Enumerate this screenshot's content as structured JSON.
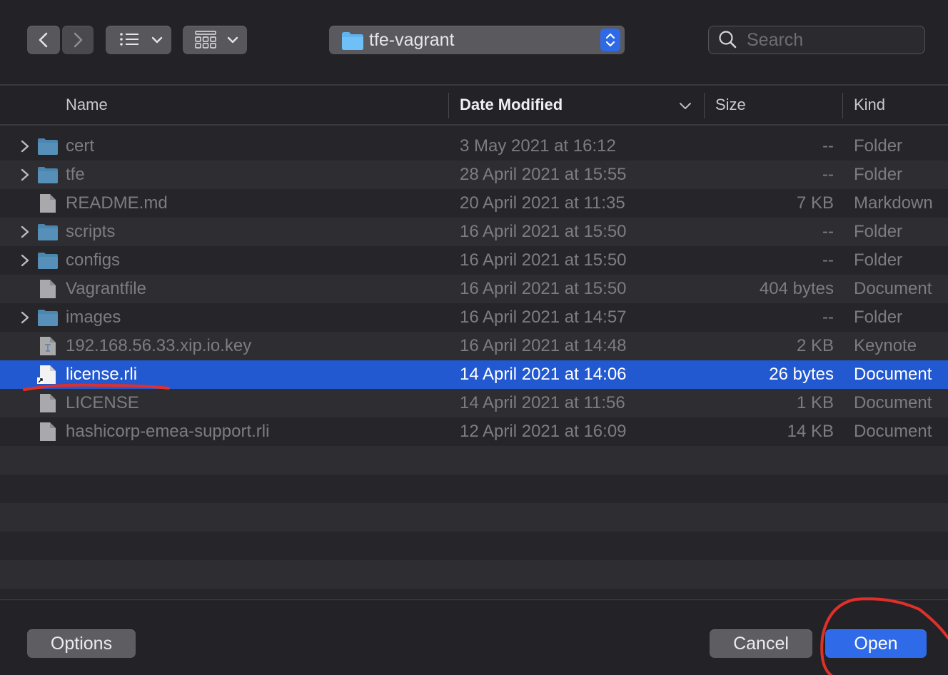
{
  "toolbar": {
    "current_folder": "tfe-vagrant",
    "search_placeholder": "Search",
    "back_icon": "chevron-left-icon",
    "forward_icon": "chevron-right-icon",
    "list_view_icon": "list-icon",
    "grid_view_icon": "grid-icon"
  },
  "columns": {
    "name": "Name",
    "date": "Date Modified",
    "size": "Size",
    "kind": "Kind",
    "sorted_by": "date"
  },
  "files": [
    {
      "name": "cert",
      "date": "3 May 2021 at 16:12",
      "size": "--",
      "kind": "Folder",
      "type": "folder"
    },
    {
      "name": "tfe",
      "date": "28 April 2021 at 15:55",
      "size": "--",
      "kind": "Folder",
      "type": "folder"
    },
    {
      "name": "README.md",
      "date": "20 April 2021 at 11:35",
      "size": "7 KB",
      "kind": "Markdown",
      "type": "doc"
    },
    {
      "name": "scripts",
      "date": "16 April 2021 at 15:50",
      "size": "--",
      "kind": "Folder",
      "type": "folder"
    },
    {
      "name": "configs",
      "date": "16 April 2021 at 15:50",
      "size": "--",
      "kind": "Folder",
      "type": "folder"
    },
    {
      "name": "Vagrantfile",
      "date": "16 April 2021 at 15:50",
      "size": "404 bytes",
      "kind": "Document",
      "type": "doc"
    },
    {
      "name": "images",
      "date": "16 April 2021 at 14:57",
      "size": "--",
      "kind": "Folder",
      "type": "folder"
    },
    {
      "name": "192.168.56.33.xip.io.key",
      "date": "16 April 2021 at 14:48",
      "size": "2 KB",
      "kind": "Keynote",
      "type": "keynote"
    },
    {
      "name": "license.rli",
      "date": "14 April 2021 at 14:06",
      "size": "26 bytes",
      "kind": "Document",
      "type": "alias",
      "selected": true
    },
    {
      "name": "LICENSE",
      "date": "14 April 2021 at 11:56",
      "size": "1 KB",
      "kind": "Document",
      "type": "doc"
    },
    {
      "name": "hashicorp-emea-support.rli",
      "date": "12 April 2021 at 16:09",
      "size": "14 KB",
      "kind": "Document",
      "type": "doc"
    }
  ],
  "footer": {
    "options_label": "Options",
    "cancel_label": "Cancel",
    "open_label": "Open"
  },
  "colors": {
    "accent": "#2f6ae8",
    "selection": "#2258d0",
    "folder": "#4a86b0",
    "annotation": "#e0302a"
  }
}
